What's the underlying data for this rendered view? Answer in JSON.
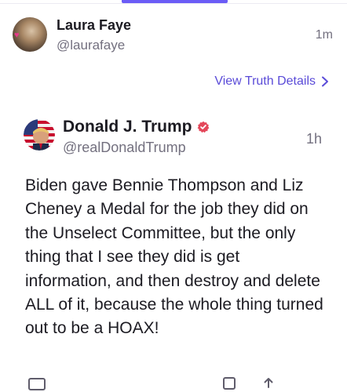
{
  "reply": {
    "display_name": "Laura Faye",
    "handle": "@laurafaye",
    "time": "1m",
    "avatar_icon": "profile-photo"
  },
  "view_details": {
    "label": "View Truth Details",
    "icon": "chevron-right-icon"
  },
  "post": {
    "display_name": "Donald J. Trump",
    "handle": "@realDonaldTrump",
    "time": "1h",
    "verified_icon": "verified-badge-icon",
    "avatar_icon": "profile-photo-flag",
    "text": "Biden gave Bennie Thompson and Liz Cheney a Medal for the job they did on the Unselect Committee, but the only thing that I see they did is get information, and then destroy and delete ALL of it, because the whole thing turned out to be a HOAX!"
  },
  "colors": {
    "accent": "#5a4bd8",
    "tab_indicator": "#6b5cf6",
    "verified": "#e4475a",
    "text_primary": "#1c1b22",
    "text_secondary": "#73707f"
  }
}
